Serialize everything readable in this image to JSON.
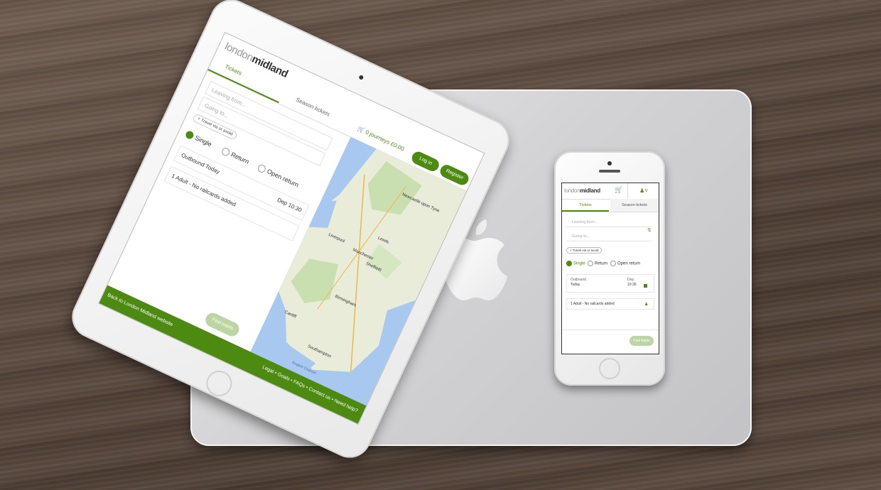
{
  "ipad": {
    "logo": {
      "light": "london",
      "bold": "midland"
    },
    "tabs": {
      "tickets": "Tickets",
      "season": "Season tickets"
    },
    "cart": "🛒 0 journeys  £0.00",
    "login": "Log in",
    "register": "Register",
    "leaving_from": "Leaving from...",
    "going_to": "Going to...",
    "travel_via": "+ Travel via or avoid",
    "radio": {
      "single": "Single",
      "return": "Return",
      "open_return": "Open return"
    },
    "outbound": "Outbound  Today",
    "dep": "Dep 10:30",
    "passengers": "1 Adult - No railcards added",
    "find_trains": "Find trains",
    "back_link": "Back to London Midland website",
    "footer_links": "Legal • Goals • FAQs • Contact us • Need help?",
    "map_places": [
      "Newcastle upon Tyne",
      "Leeds",
      "Manchester",
      "Liverpool",
      "Sheffield",
      "Birmingham",
      "Cardiff",
      "Southampton",
      "English Channel"
    ]
  },
  "iphone": {
    "logo": {
      "light": "london",
      "bold": "midland"
    },
    "tabs": {
      "tickets": "Tickets",
      "season": "Season tickets"
    },
    "leaving_from": "Leaving from...",
    "going_to": "Going to...",
    "travel_via": "+ Travel via or avoid",
    "radio": {
      "single": "Single",
      "return": "Return",
      "open_return": "Open return"
    },
    "outbound_label": "Outbound",
    "outbound_value": "Today",
    "dep_label": "Dep",
    "dep_value": "10:30",
    "passengers": "1 Adult - No railcards added",
    "find_trains": "Find trains"
  },
  "colors": {
    "brand_green": "#4d8a12",
    "button_disabled": "#bcd5a3"
  }
}
